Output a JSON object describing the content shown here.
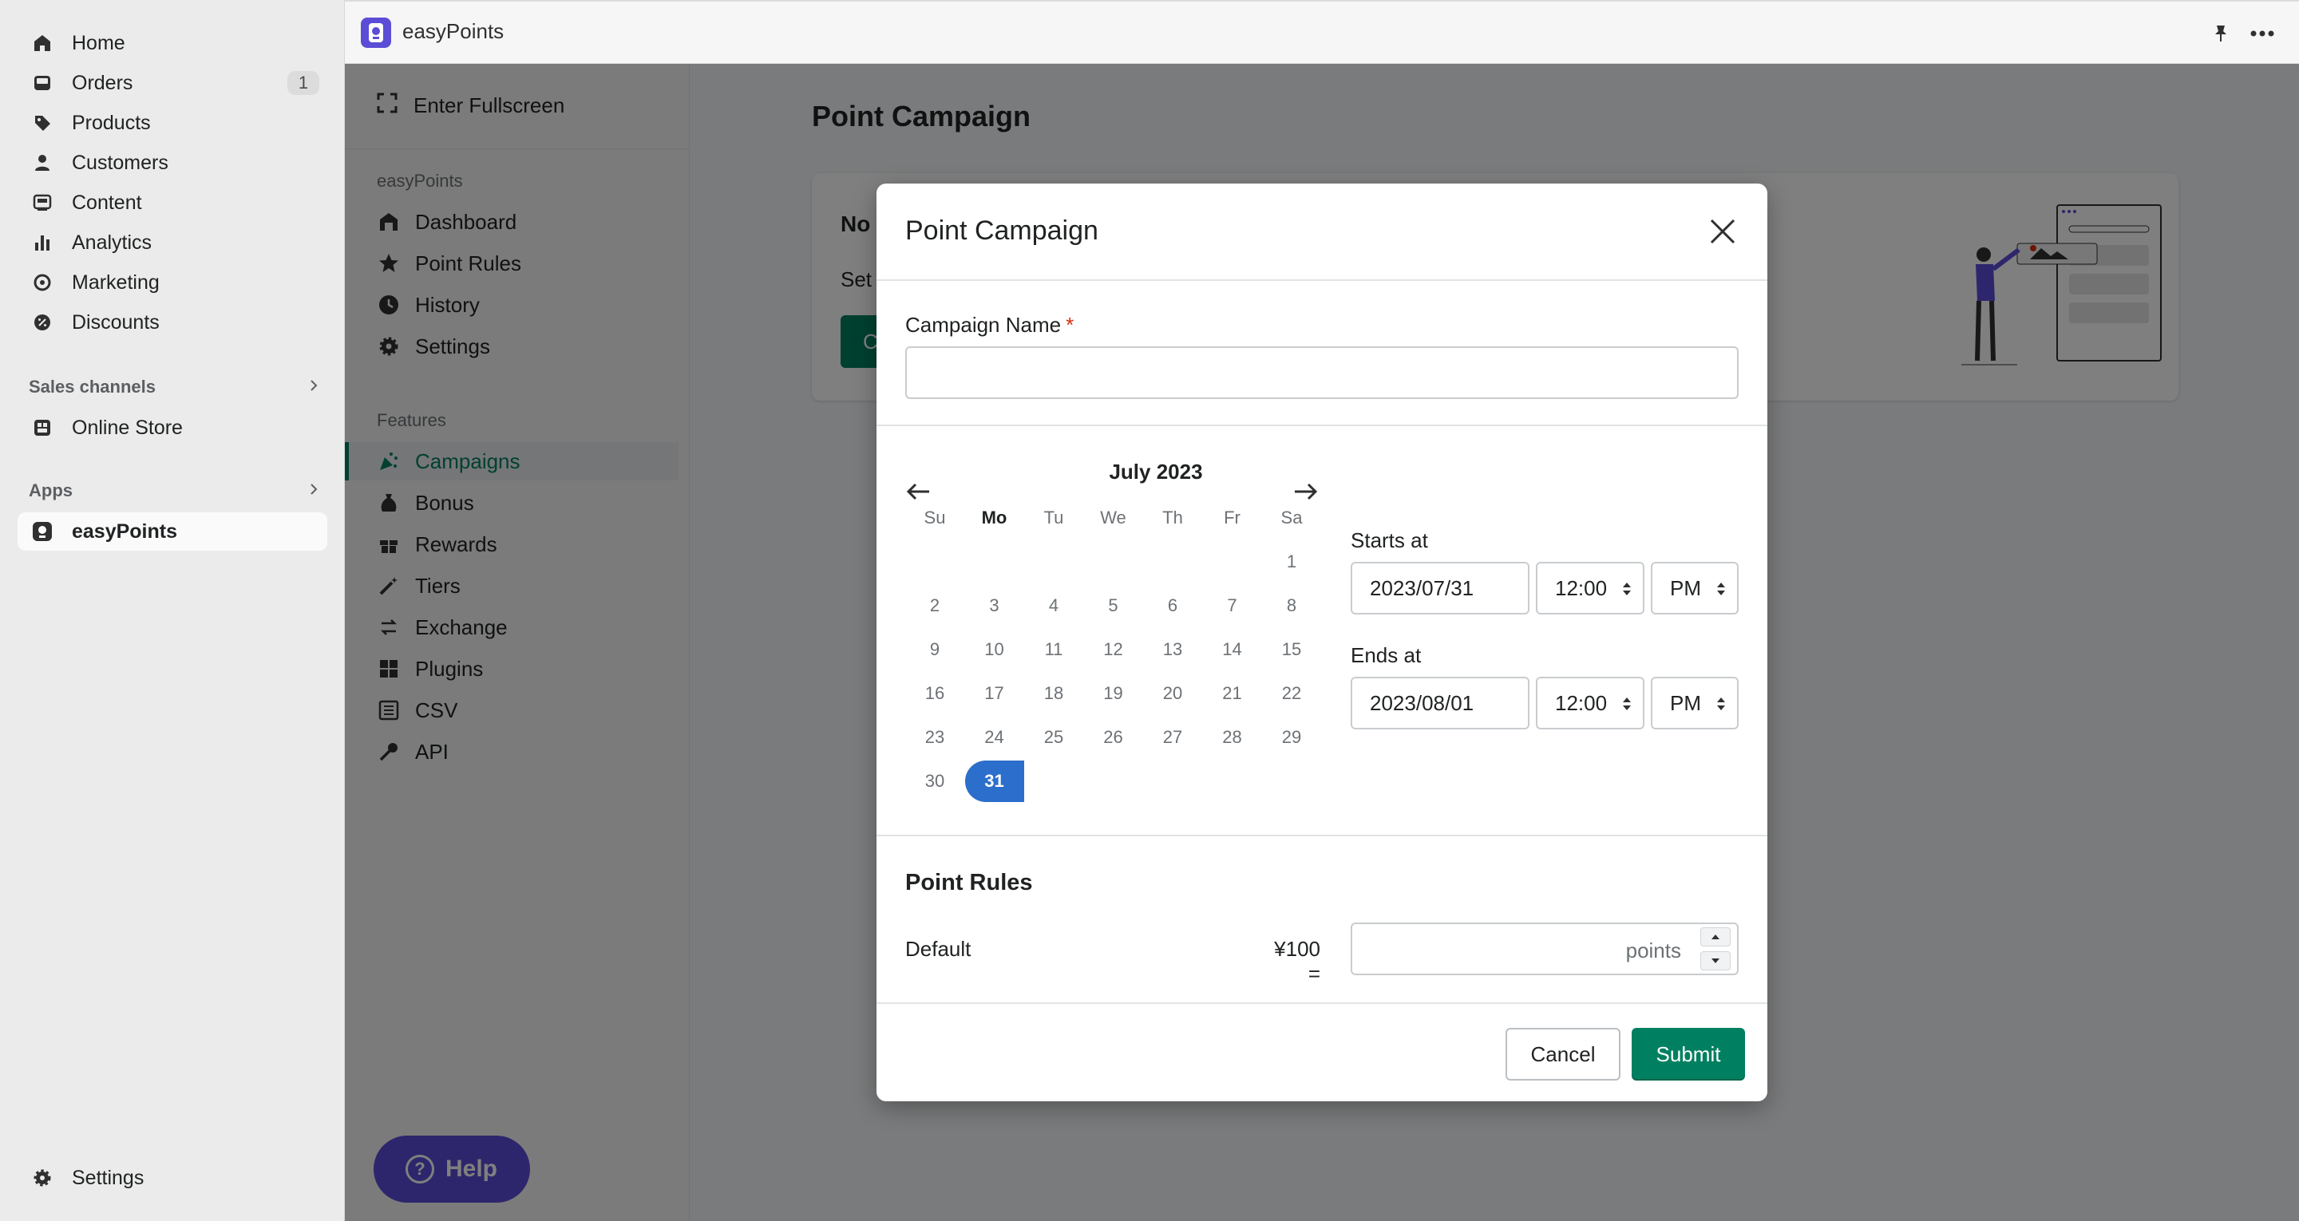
{
  "shopify_nav": {
    "items": [
      {
        "label": "Home",
        "icon": "home-icon"
      },
      {
        "label": "Orders",
        "icon": "orders-icon",
        "badge": "1"
      },
      {
        "label": "Products",
        "icon": "tag-icon"
      },
      {
        "label": "Customers",
        "icon": "person-icon"
      },
      {
        "label": "Content",
        "icon": "content-icon"
      },
      {
        "label": "Analytics",
        "icon": "bar-chart-icon"
      },
      {
        "label": "Marketing",
        "icon": "target-icon"
      },
      {
        "label": "Discounts",
        "icon": "discount-icon"
      }
    ],
    "sales_channels_label": "Sales channels",
    "online_store_label": "Online Store",
    "apps_label": "Apps",
    "easypoints_label": "easyPoints",
    "settings_label": "Settings"
  },
  "topbar": {
    "app_title": "easyPoints"
  },
  "app_sidebar": {
    "fullscreen_label": "Enter Fullscreen",
    "section1_heading": "easyPoints",
    "section1_items": [
      {
        "label": "Dashboard",
        "icon": "dashboard-icon"
      },
      {
        "label": "Point Rules",
        "icon": "star-icon"
      },
      {
        "label": "History",
        "icon": "clock-icon"
      },
      {
        "label": "Settings",
        "icon": "gear-icon"
      }
    ],
    "section2_heading": "Features",
    "section2_items": [
      {
        "label": "Campaigns",
        "icon": "party-icon",
        "active": true
      },
      {
        "label": "Bonus",
        "icon": "bag-icon"
      },
      {
        "label": "Rewards",
        "icon": "gift-icon"
      },
      {
        "label": "Tiers",
        "icon": "wand-icon"
      },
      {
        "label": "Exchange",
        "icon": "exchange-icon"
      },
      {
        "label": "Plugins",
        "icon": "plugins-icon"
      },
      {
        "label": "CSV",
        "icon": "list-icon"
      },
      {
        "label": "API",
        "icon": "key-icon"
      }
    ]
  },
  "page": {
    "title": "Point Campaign",
    "card_heading": "No",
    "card_text": "Set",
    "card_button": "C",
    "help_label": "Help"
  },
  "modal": {
    "title": "Point Campaign",
    "campaign_name_label": "Campaign Name",
    "required_mark": "*",
    "campaign_name_value": "",
    "calendar": {
      "month_label": "July 2023",
      "weekdays": [
        "Su",
        "Mo",
        "Tu",
        "We",
        "Th",
        "Fr",
        "Sa"
      ],
      "days": [
        "1",
        "2",
        "3",
        "4",
        "5",
        "6",
        "7",
        "8",
        "9",
        "10",
        "11",
        "12",
        "13",
        "14",
        "15",
        "16",
        "17",
        "18",
        "19",
        "20",
        "21",
        "22",
        "23",
        "24",
        "25",
        "26",
        "27",
        "28",
        "29",
        "30",
        "31"
      ],
      "selected_day": "31"
    },
    "starts_at": {
      "label": "Starts at",
      "date": "2023/07/31",
      "time": "12:00",
      "ampm": "PM"
    },
    "ends_at": {
      "label": "Ends at",
      "date": "2023/08/01",
      "time": "12:00",
      "ampm": "PM"
    },
    "point_rules": {
      "title": "Point Rules",
      "default_label": "Default",
      "rate": "¥100 =",
      "points_suffix": "points",
      "points_value": ""
    },
    "cancel_label": "Cancel",
    "submit_label": "Submit"
  },
  "colors": {
    "accent_green": "#008060",
    "selected_blue": "#2c6ecb",
    "brand_purple": "#5c4dd9",
    "required_red": "#d72c0d"
  }
}
